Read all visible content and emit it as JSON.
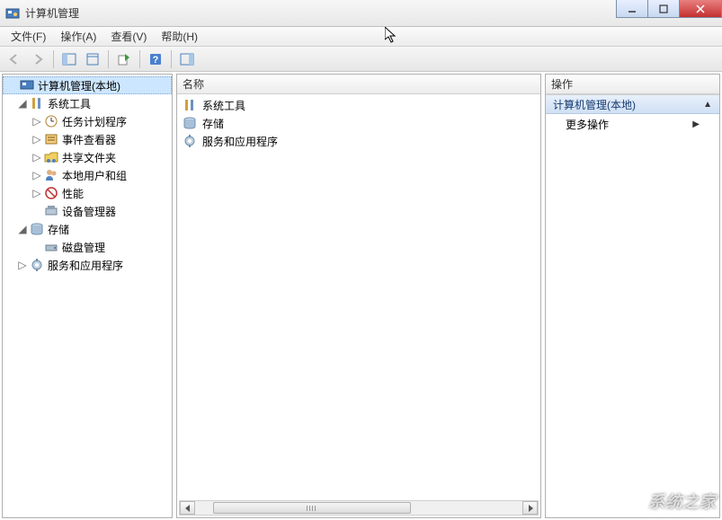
{
  "title": "计算机管理",
  "menus": {
    "file": "文件(F)",
    "action": "操作(A)",
    "view": "查看(V)",
    "help": "帮助(H)"
  },
  "tree": {
    "root": "计算机管理(本地)",
    "system_tools": "系统工具",
    "task_scheduler": "任务计划程序",
    "event_viewer": "事件查看器",
    "shared_folders": "共享文件夹",
    "local_users": "本地用户和组",
    "performance": "性能",
    "device_manager": "设备管理器",
    "storage": "存储",
    "disk_management": "磁盘管理",
    "services_apps": "服务和应用程序"
  },
  "center": {
    "column_name": "名称",
    "items": {
      "system_tools": "系统工具",
      "storage": "存储",
      "services_apps": "服务和应用程序"
    }
  },
  "actions": {
    "header": "操作",
    "context": "计算机管理(本地)",
    "more": "更多操作"
  },
  "watermark": "系统之家"
}
